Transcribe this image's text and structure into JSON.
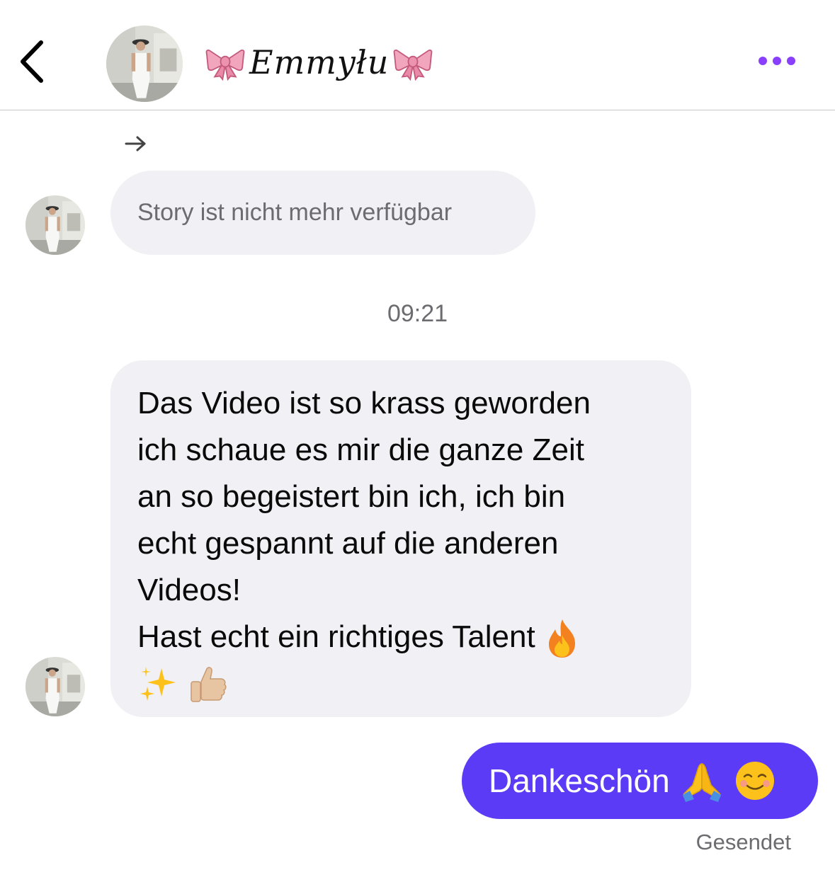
{
  "header": {
    "title": "Emmyłu",
    "back_icon": "chevron-left-icon",
    "more_icon": "more-horizontal-icon",
    "accent": "#8a3ffc"
  },
  "messages": {
    "story_reply": {
      "icon": "reply-arrow-icon",
      "text": "Story ist nicht mehr verfügbar"
    },
    "timestamp": "09:21",
    "received": {
      "lines": [
        "Das Video ist so krass geworden",
        "ich schaue es mir die ganze Zeit",
        "an so begeistert bin ich, ich bin",
        "echt gespannt auf die anderen",
        "Videos!",
        "Hast echt ein richtiges Talent"
      ],
      "emojis": [
        "fire",
        "sparkles",
        "thumbs-up"
      ]
    },
    "sent": {
      "text": "Dankeschön",
      "emojis": [
        "folded-hands",
        "smiling-face"
      ],
      "color": "#5b3bf5"
    },
    "status": "Gesendet"
  }
}
